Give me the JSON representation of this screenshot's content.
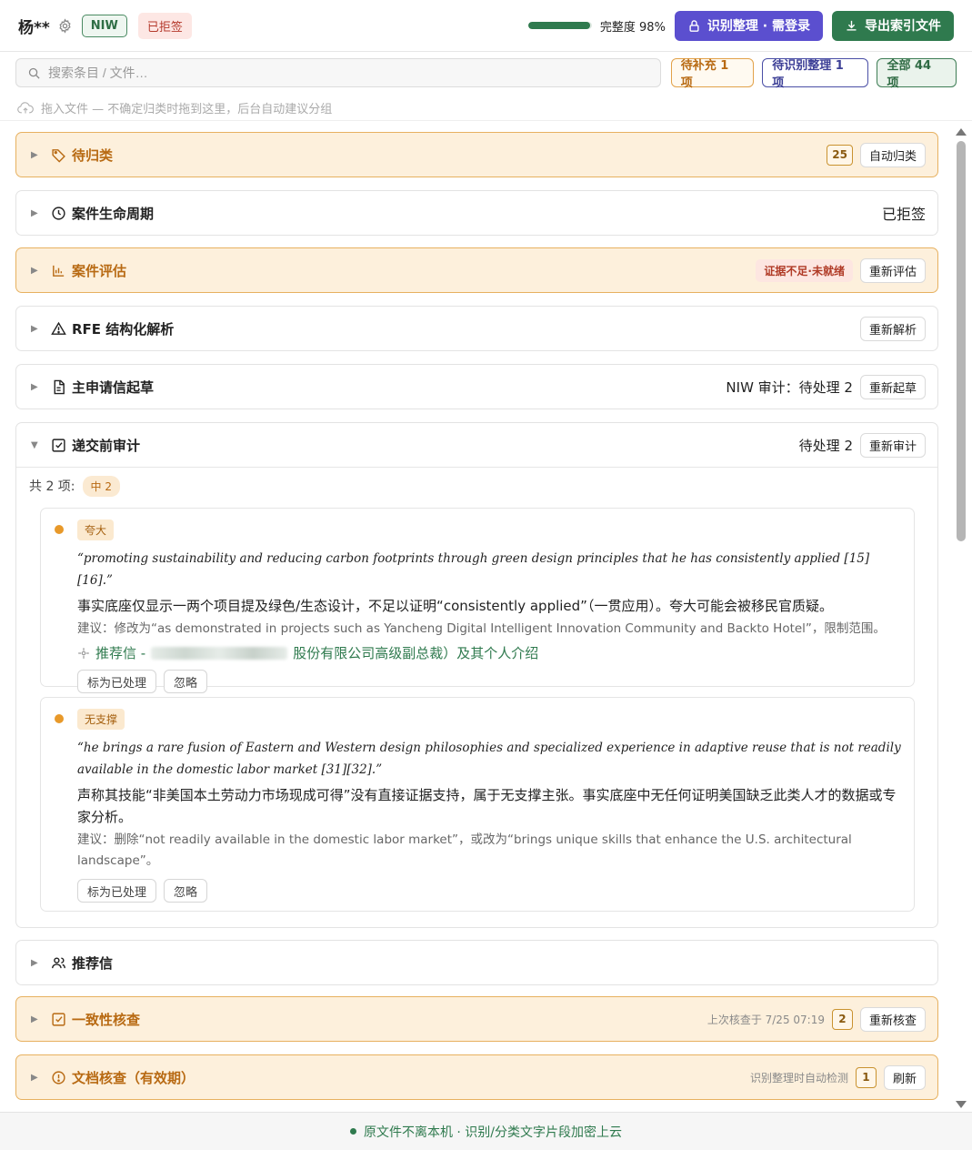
{
  "header": {
    "client_name": "杨**",
    "visa_tag": "NIW",
    "status_tag": "已拒签",
    "completeness_label": "完整度 98%",
    "completeness_value": 98,
    "recognize_button": "识别整理 · 需登录",
    "export_button": "导出索引文件",
    "colors": {
      "accent_purple": "#5b4fcf",
      "accent_green": "#2f7a4e"
    }
  },
  "search": {
    "placeholder": "搜索条目 / 文件…",
    "filter_pending": "待补充 1 项",
    "filter_recognize": "待识别整理 1 项",
    "filter_all": "全部 44 项"
  },
  "drop_hint": "拖入文件 — 不确定归类时拖到这里，后台自动建议分组",
  "sections": {
    "uncategorized": {
      "title": "待归类",
      "count": "25",
      "button": "自动归类"
    },
    "lifecycle": {
      "title": "案件生命周期",
      "status": "已拒签"
    },
    "assessment": {
      "title": "案件评估",
      "badge": "证据不足·未就绪",
      "button": "重新评估"
    },
    "rfe": {
      "title": "RFE 结构化解析",
      "button": "重新解析"
    },
    "petition": {
      "title": "主申请信起草",
      "status": "NIW  审计：待处理 2",
      "button": "重新起草"
    },
    "audit": {
      "title": "递交前审计",
      "status": "待处理 2",
      "button": "重新审计",
      "total_label": "共 2 项:",
      "severity_badge": "中 2",
      "issues": [
        {
          "type": "夸大",
          "quote": "“promoting sustainability and reducing carbon footprints through green design principles that he has consistently applied [15][16].”",
          "desc": "事实底座仅显示一两个项目提及绿色/生态设计，不足以证明“consistently applied”（一贯应用）。夸大可能会被移民官质疑。",
          "suggest": "建议：修改为“as demonstrated in projects such as Yancheng Digital Intelligent Innovation Community and Backto Hotel”，限制范围。",
          "source_prefix": "推荐信 -",
          "source_suffix": "股份有限公司高级副总裁）及其个人介绍",
          "mark_done": "标为已处理",
          "ignore": "忽略"
        },
        {
          "type": "无支撑",
          "quote": "“he brings a rare fusion of Eastern and Western design philosophies and specialized experience in adaptive reuse that is not readily available in the domestic labor market [31][32].”",
          "desc": "声称其技能“非美国本土劳动力市场现成可得”没有直接证据支持，属于无支撑主张。事实底座中无任何证明美国缺乏此类人才的数据或专家分析。",
          "suggest": "建议：删除“not readily available in the domestic labor market”，或改为“brings unique skills that enhance the U.S. architectural landscape”。",
          "mark_done": "标为已处理",
          "ignore": "忽略"
        }
      ]
    },
    "recommendation": {
      "title": "推荐信"
    },
    "consistency": {
      "title": "一致性核查",
      "last_check": "上次核查于 7/25 07:19",
      "count": "2",
      "button": "重新核查"
    },
    "validity": {
      "title": "文档核查（有效期）",
      "note": "识别整理时自动检测",
      "count": "1",
      "button": "刷新"
    }
  },
  "footer": {
    "text": "原文件不离本机 · 识别/分类文字片段加密上云"
  }
}
